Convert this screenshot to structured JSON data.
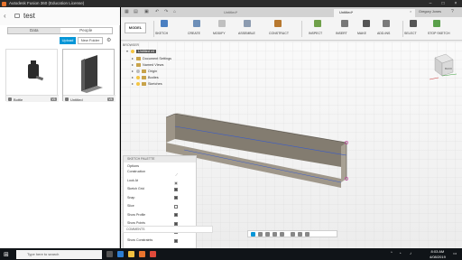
{
  "window": {
    "title": "Autodesk Fusion 360 (Education License)"
  },
  "data_panel": {
    "project_name": "test",
    "tabs": [
      "Data",
      "People"
    ],
    "upload_label": "Upload",
    "new_folder_label": "New Folder",
    "files": [
      {
        "name": "Bottle",
        "version": "V1"
      },
      {
        "name": "Untitled",
        "version": "V4"
      }
    ]
  },
  "doc_tabs": {
    "tabs": [
      "Untitled*",
      "Untitled*"
    ],
    "active_tab": 1,
    "user_name": "Gregory Jones"
  },
  "ribbon": {
    "workspace": "MODEL",
    "groups": [
      "SKETCH",
      "CREATE",
      "MODIFY",
      "ASSEMBLE",
      "CONSTRUCT",
      "INSPECT",
      "INSERT",
      "MAKE",
      "ADD-INS",
      "SELECT",
      "STOP SKETCH"
    ],
    "icon_colors": [
      "#4a7fc1",
      "#6d8fb8",
      "#c0c0c0",
      "#8c9bb0",
      "#b7782f",
      "#6fa04a",
      "#777777",
      "#555555",
      "#7a7a7a",
      "#555555",
      "#5aa04a"
    ]
  },
  "browser": {
    "header": "BROWSER",
    "root": "Untitled v4",
    "items": [
      "Document Settings",
      "Named Views",
      "Origin",
      "Bodies",
      "Sketches"
    ]
  },
  "sketch_palette": {
    "header": "SKETCH PALETTE",
    "section": "Options",
    "rows": [
      {
        "label": "Construction",
        "type": "icon",
        "icon": "construction-icon"
      },
      {
        "label": "Look At",
        "type": "icon",
        "icon": "look-at-icon"
      },
      {
        "label": "Sketch Grid",
        "type": "check",
        "checked": true
      },
      {
        "label": "Snap",
        "type": "check",
        "checked": true
      },
      {
        "label": "Slice",
        "type": "check",
        "checked": false
      },
      {
        "label": "Show Profile",
        "type": "check",
        "checked": true
      },
      {
        "label": "Show Points",
        "type": "check",
        "checked": true
      },
      {
        "label": "Show Dimensions",
        "type": "check",
        "checked": true
      },
      {
        "label": "Show Constraints",
        "type": "check",
        "checked": true
      }
    ]
  },
  "viewcube": {
    "face_label": "BACK"
  },
  "comments": {
    "label": "COMMENTS"
  },
  "taskbar": {
    "search_placeholder": "Type here to search",
    "time": "8:03 AM",
    "date": "4/08/2019"
  },
  "colors": {
    "accent": "#0696d7",
    "taskbar": "#101418",
    "model_face": "#9d9588"
  }
}
